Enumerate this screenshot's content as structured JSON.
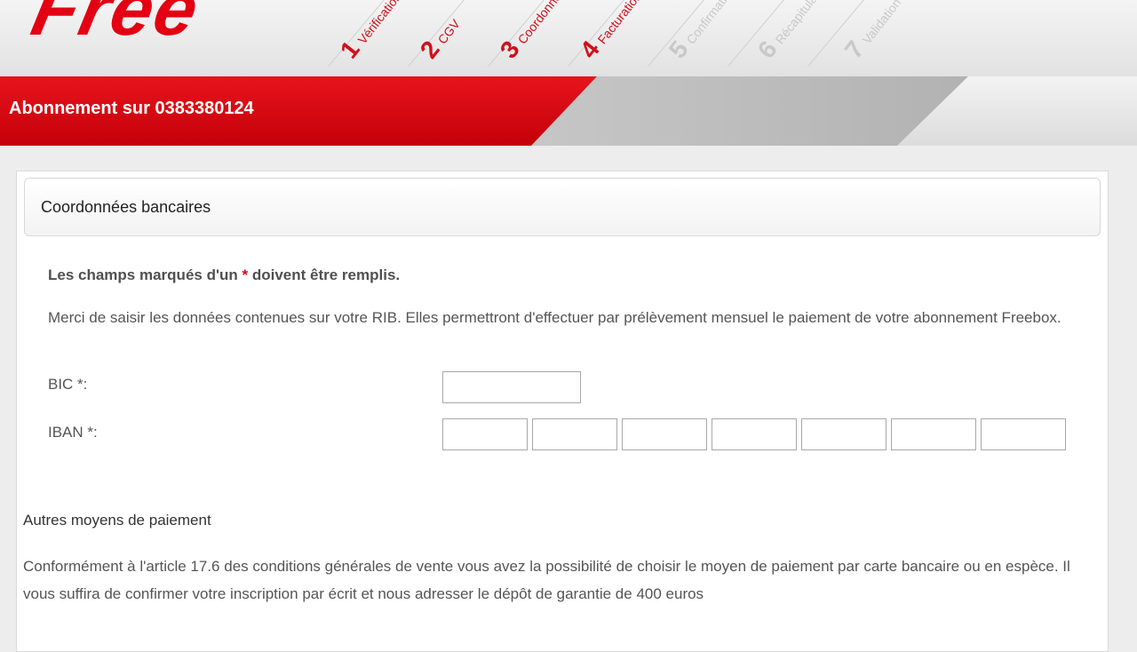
{
  "brand": {
    "logo_text": "Free",
    "accent_color": "#e30013"
  },
  "steps": [
    {
      "number": "1",
      "label": "Vérification",
      "state": "done"
    },
    {
      "number": "2",
      "label": "CGV",
      "state": "done"
    },
    {
      "number": "3",
      "label": "Coordonnées",
      "state": "done"
    },
    {
      "number": "4",
      "label": "Facturation",
      "state": "done"
    },
    {
      "number": "5",
      "label": "Confirmation",
      "state": "todo"
    },
    {
      "number": "6",
      "label": "Récapitulatif",
      "state": "todo"
    },
    {
      "number": "7",
      "label": "Validation",
      "state": "todo"
    }
  ],
  "banner": {
    "title": "Abonnement sur 0383380124"
  },
  "section": {
    "title": "Coordonnées bancaires",
    "required_prefix": "Les champs marqués d'un ",
    "required_star": "*",
    "required_suffix": " doivent être remplis.",
    "intro": "Merci de saisir les données contenues sur votre RIB. Elles permettront d'effectuer par prélèvement mensuel le paiement de votre abonnement Freebox."
  },
  "form": {
    "bic_label": "BIC *:",
    "bic_value": "",
    "iban_label": "IBAN *:",
    "iban_values": [
      "",
      "",
      "",
      "",
      "",
      "",
      ""
    ]
  },
  "other_payment": {
    "title": "Autres moyens de paiement",
    "text": "Conformément à l'article 17.6 des conditions générales de vente vous avez la possibilité de choisir le moyen de paiement par carte bancaire ou en espèce. Il vous suffira de confirmer votre inscription par écrit et nous adresser le dépôt de garantie de 400 euros"
  }
}
